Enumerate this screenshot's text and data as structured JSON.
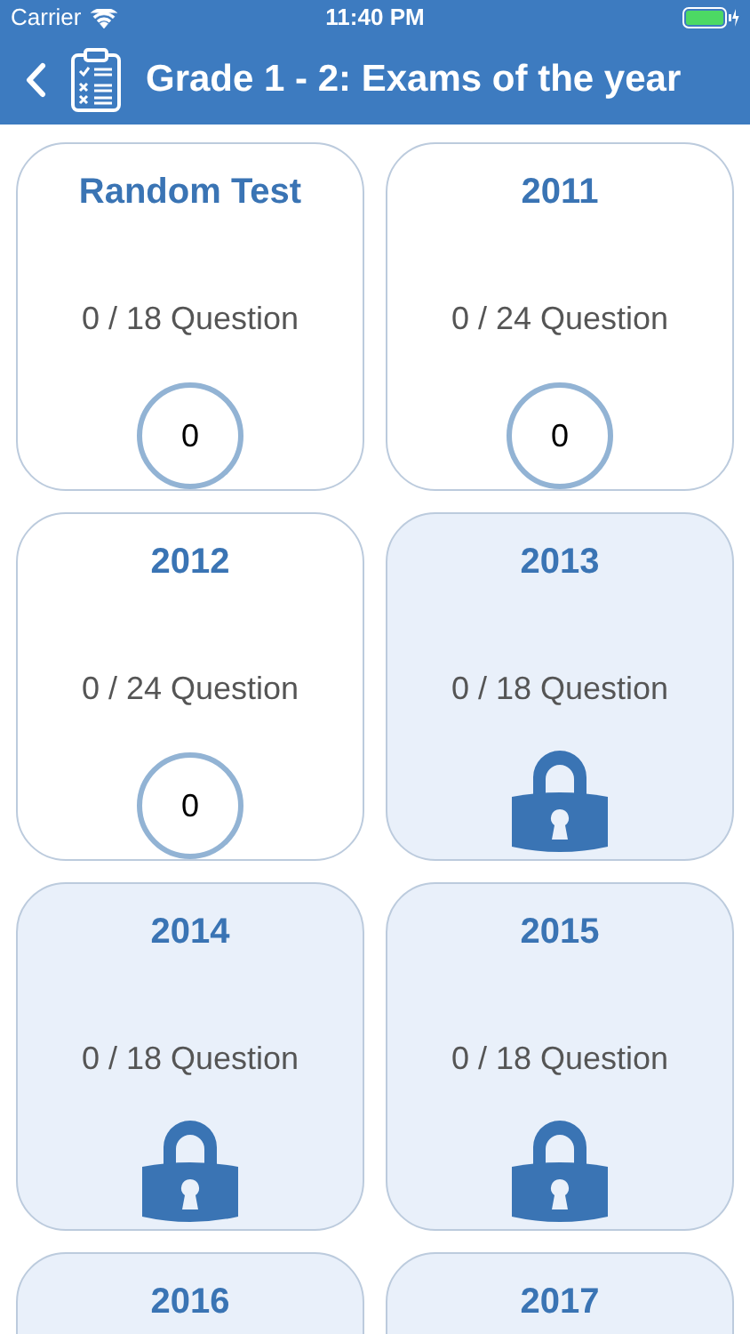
{
  "status_bar": {
    "carrier": "Carrier",
    "time": "11:40 PM"
  },
  "nav": {
    "title": "Grade 1 - 2: Exams of the year"
  },
  "cards": [
    {
      "title": "Random Test",
      "progress": "0 / 18 Question",
      "locked": false,
      "score": "0"
    },
    {
      "title": "2011",
      "progress": "0 / 24 Question",
      "locked": false,
      "score": "0"
    },
    {
      "title": "2012",
      "progress": "0 / 24 Question",
      "locked": false,
      "score": "0"
    },
    {
      "title": "2013",
      "progress": "0 / 18 Question",
      "locked": true
    },
    {
      "title": "2014",
      "progress": "0 / 18 Question",
      "locked": true
    },
    {
      "title": "2015",
      "progress": "0 / 18 Question",
      "locked": true
    },
    {
      "title": "2016",
      "locked": true
    },
    {
      "title": "2017",
      "locked": true
    }
  ]
}
